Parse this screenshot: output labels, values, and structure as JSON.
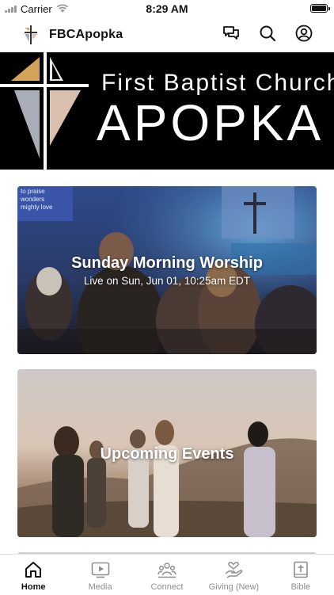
{
  "status_bar": {
    "carrier": "Carrier",
    "time": "8:29 AM"
  },
  "header": {
    "title": "FBCApopka",
    "icons": [
      "chat-icon",
      "search-icon",
      "profile-icon"
    ]
  },
  "banner": {
    "line1": "First Baptist Church",
    "line2": "APOPKA"
  },
  "cards": {
    "worship": {
      "title": "Sunday Morning Worship",
      "subtitle": "Live on Sun, Jun 01, 10:25am EDT",
      "screen_text": "to praise\nwonders\nmighty love"
    },
    "events": {
      "title": "Upcoming Events"
    }
  },
  "tabs": [
    {
      "label": "Home",
      "icon": "home-icon",
      "active": true
    },
    {
      "label": "Media",
      "icon": "media-icon",
      "active": false
    },
    {
      "label": "Connect",
      "icon": "connect-icon",
      "active": false
    },
    {
      "label": "Giving (New)",
      "icon": "giving-icon",
      "active": false
    },
    {
      "label": "Bible",
      "icon": "bible-icon",
      "active": false
    }
  ],
  "colors": {
    "accent": "#111111",
    "inactive_tab": "#8e8e8e",
    "banner_bg": "#000000",
    "logo_gold": "#d4a35a",
    "logo_gray": "#a8adb8",
    "logo_tan": "#d8bfae"
  }
}
